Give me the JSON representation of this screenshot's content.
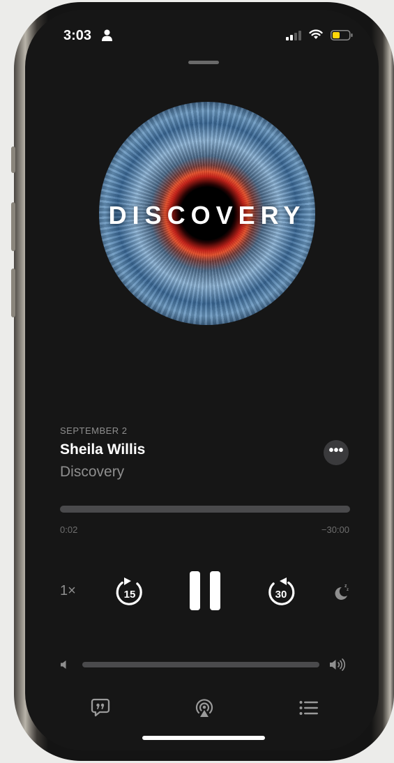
{
  "status_bar": {
    "time": "3:03",
    "icons": [
      "person-icon",
      "cellular-signal-icon",
      "wifi-icon",
      "battery-icon"
    ],
    "battery_color": "#ffd60a"
  },
  "artwork": {
    "title": "DISCOVERY"
  },
  "episode": {
    "date": "SEPTEMBER 2",
    "title": "Sheila Willis",
    "show": "Discovery"
  },
  "playback": {
    "elapsed": "0:02",
    "remaining": "−30:00",
    "progress_fraction": 0.001,
    "speed": "1×",
    "skip_back_seconds": "15",
    "skip_forward_seconds": "30",
    "state": "playing"
  },
  "volume": {
    "level_fraction": 0.0
  },
  "bottom_bar": {
    "items": [
      "lyrics-icon",
      "airplay-icon",
      "queue-icon"
    ]
  },
  "colors": {
    "background": "#161616",
    "track": "#4a4a4c",
    "secondary_text": "#8e8e8e"
  }
}
